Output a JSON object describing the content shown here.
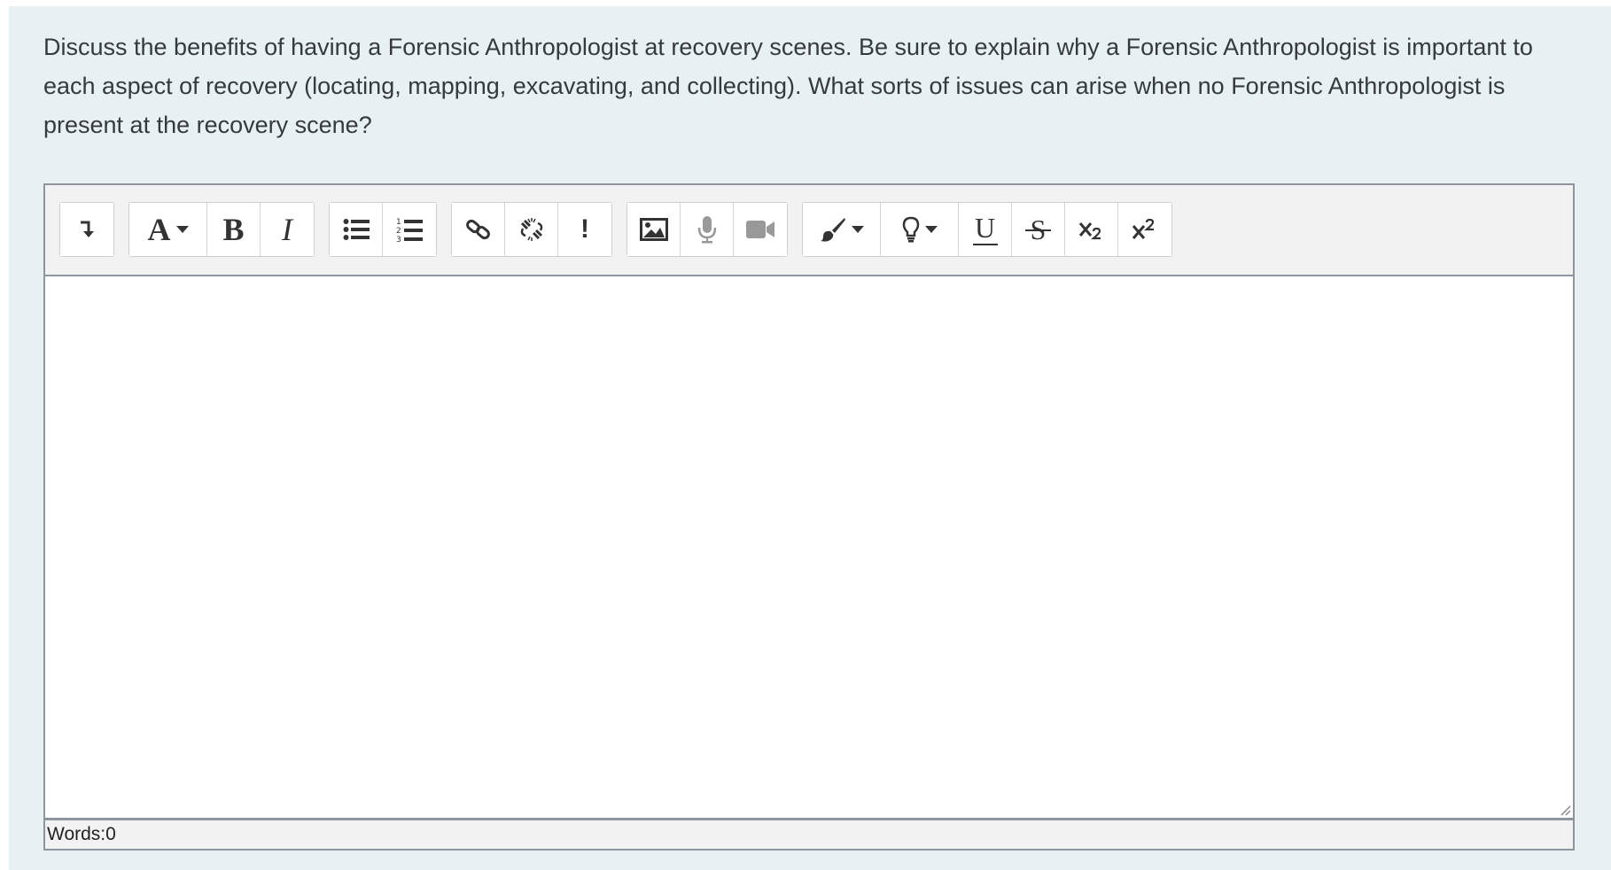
{
  "question": {
    "text": "Discuss the benefits of having a Forensic Anthropologist at recovery scenes. Be sure to explain why a Forensic Anthropologist is important to each aspect of recovery (locating, mapping, excavating, and collecting). What sorts of issues can arise when no Forensic Anthropologist is present at the recovery scene?"
  },
  "toolbar": {
    "icons": {
      "toggle": "arrow-down-right-icon",
      "font": "font-style-icon",
      "bold": "bold-icon",
      "italic": "italic-icon",
      "bullets": "unordered-list-icon",
      "numbers": "ordered-list-icon",
      "link": "link-icon",
      "unlink": "unlink-icon",
      "special": "exclamation-icon",
      "image": "image-icon",
      "audio": "microphone-icon",
      "video": "video-camera-icon",
      "brush": "paintbrush-icon",
      "bulb": "lightbulb-icon",
      "underline": "underline-icon",
      "strike": "strikethrough-icon",
      "subscript": "subscript-icon",
      "superscript": "superscript-icon"
    },
    "font_glyph": "A",
    "bold_glyph": "B",
    "italic_glyph": "I",
    "underline_glyph": "U",
    "strike_glyph": "S",
    "special_glyph": "!"
  },
  "editor": {
    "content": ""
  },
  "status": {
    "words_label": "Words:",
    "words_count": "0"
  },
  "colors": {
    "card_bg": "#e7f1f4",
    "toolbar_bg": "#f2f2f2",
    "border": "#8f959e",
    "text": "#373a3c"
  }
}
